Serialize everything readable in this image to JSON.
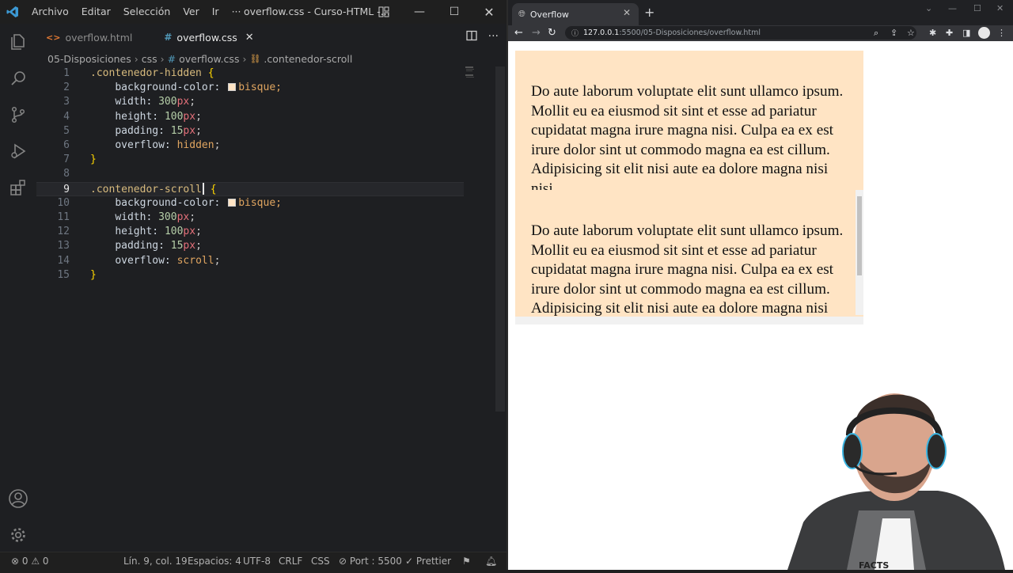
{
  "vscode": {
    "menu": [
      "Archivo",
      "Editar",
      "Selección",
      "Ver",
      "Ir",
      "···"
    ],
    "window_title": "overflow.css - Curso-HTML -...",
    "tabs": [
      {
        "label": "overflow.html",
        "active": false
      },
      {
        "label": "overflow.css",
        "active": true
      }
    ],
    "breadcrumb": [
      "05-Disposiciones",
      "css",
      "overflow.css",
      ".contenedor-scroll"
    ],
    "code": {
      "lines": [
        {
          "n": "1"
        },
        {
          "n": "2"
        },
        {
          "n": "3"
        },
        {
          "n": "4"
        },
        {
          "n": "5"
        },
        {
          "n": "6"
        },
        {
          "n": "7"
        },
        {
          "n": "8"
        },
        {
          "n": "9"
        },
        {
          "n": "10"
        },
        {
          "n": "11"
        },
        {
          "n": "12"
        },
        {
          "n": "13"
        },
        {
          "n": "14"
        },
        {
          "n": "15"
        }
      ],
      "selector_hidden": ".contenedor-hidden",
      "selector_scroll": ".contenedor-scroll",
      "open_brace": "{",
      "close_brace": "}",
      "prop_bg": "background-color:",
      "val_bg": "bisque;",
      "prop_width": "width:",
      "prop_height": "height:",
      "prop_padding": "padding:",
      "prop_overflow": "overflow:",
      "num_300": "300",
      "num_100": "100",
      "num_15": "15",
      "unit_px": "px",
      "semi": ";",
      "val_hidden": "hidden",
      "val_scroll": "scroll"
    },
    "status": {
      "problems": "⊗ 0 ⚠ 0",
      "position": "Lín. 9, col. 19",
      "spaces": "Espacios: 4",
      "encoding": "UTF-8",
      "eol": "CRLF",
      "language": "CSS",
      "port": "Port : 5500",
      "prettier": "Prettier"
    },
    "colors": {
      "swatch": "#ffe4c4"
    }
  },
  "browser": {
    "tab_title": "Overflow",
    "url_host": "127.0.0.1",
    "url_path": ":5500/05-Disposiciones/overflow.html",
    "paragraph_hidden": "Do aute laborum voluptate elit sunt ullamco ipsum. Mollit eu ea eiusmod sit sint et esse ad pariatur cupidatat magna irure magna nisi. Culpa ea ex est irure dolor sint ut commodo magna ea est cillum. Adipisicing sit elit nisi aute ea dolore magna nisi nisi.",
    "paragraph_scroll": "Do aute laborum voluptate elit sunt ullamco ipsum. Mollit eu ea eiusmod sit sint et esse ad pariatur cupidatat magna irure magna nisi. Culpa ea ex est irure dolor sint ut commodo magna ea est cillum. Adipisicing sit elit nisi aute ea dolore magna nisi nisi.",
    "box_color": "#ffe4c4"
  },
  "webcam": {
    "shirt_text": "FACTS"
  }
}
